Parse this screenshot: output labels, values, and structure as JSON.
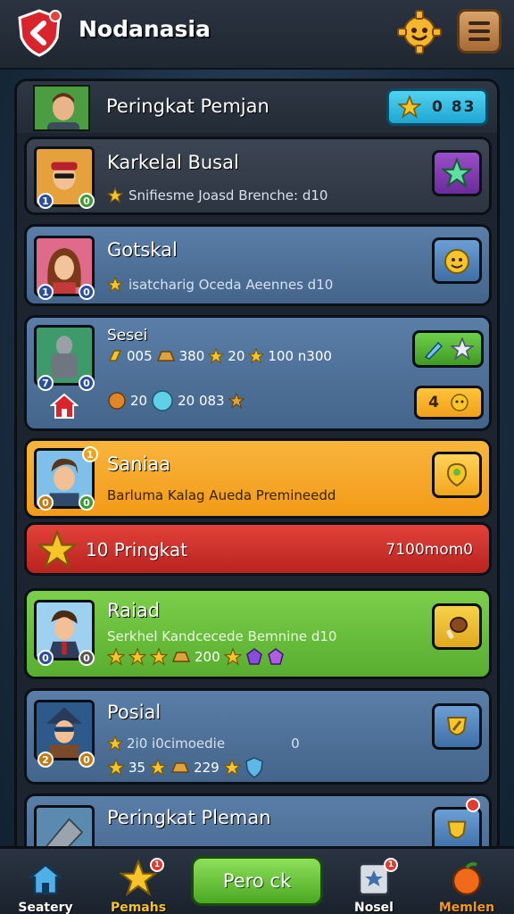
{
  "header": {
    "title": "Nodanasia"
  },
  "panel": {
    "title": "Peringkat Pemjan",
    "badge_value": "0 83"
  },
  "cards": [
    {
      "name": "Karkelal Busal",
      "sub": "Snifiesme Joasd Brenche: d10"
    },
    {
      "name": "Gotskal",
      "sub": "isatcharig Oceda Aeennes d10"
    },
    {
      "name": "Sesei",
      "row1": [
        "005",
        "380",
        "20",
        "100 n300"
      ],
      "row2": [
        "20",
        "20 083"
      ],
      "action_value": "4"
    },
    {
      "name": "Saniaa",
      "sub": "Barluma Kalag Aueda Premineedd"
    },
    {
      "name": "Raiad",
      "sub": "Serkhel Kandcecede Bemnine d10",
      "row2": [
        "200"
      ]
    },
    {
      "name": "Posial",
      "sub": "2i0 i0cimoedie",
      "sub_right": "0",
      "row2": [
        "35",
        "229"
      ]
    },
    {
      "name": "Peringkat Pleman"
    }
  ],
  "rank_banner": {
    "label": "10 Pringkat",
    "value": "7100mom0"
  },
  "nav": {
    "items": [
      {
        "label": "Seatery"
      },
      {
        "label": "Pemahs"
      },
      {
        "label": "Nosel"
      },
      {
        "label": "Memlen"
      }
    ],
    "center_label": "Pero ck",
    "badge_pemahs": "1",
    "badge_nosel": "1"
  },
  "colors": {
    "gold": "#f7c52a",
    "accent_green": "#5bb52e",
    "accent_orange": "#f39a18",
    "accent_red": "#c52a24",
    "accent_blue": "#4f7298"
  }
}
